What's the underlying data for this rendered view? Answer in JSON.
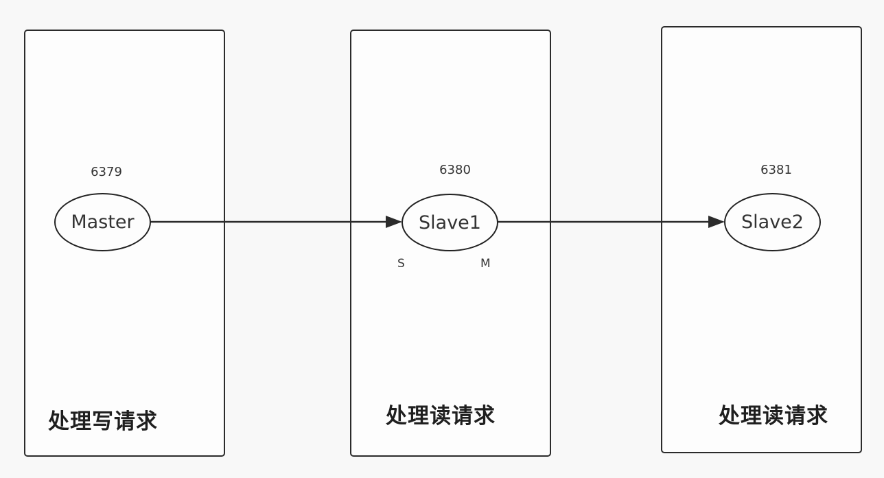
{
  "nodes": {
    "master": {
      "name": "Master",
      "port": "6379",
      "caption": "处理写请求"
    },
    "slave1": {
      "name": "Slave1",
      "port": "6380",
      "caption": "处理读请求",
      "role_left": "S",
      "role_right": "M"
    },
    "slave2": {
      "name": "Slave2",
      "port": "6381",
      "caption": "处理读请求"
    }
  },
  "colors": {
    "stroke": "#2b2b2b",
    "background": "#f8f8f8"
  }
}
